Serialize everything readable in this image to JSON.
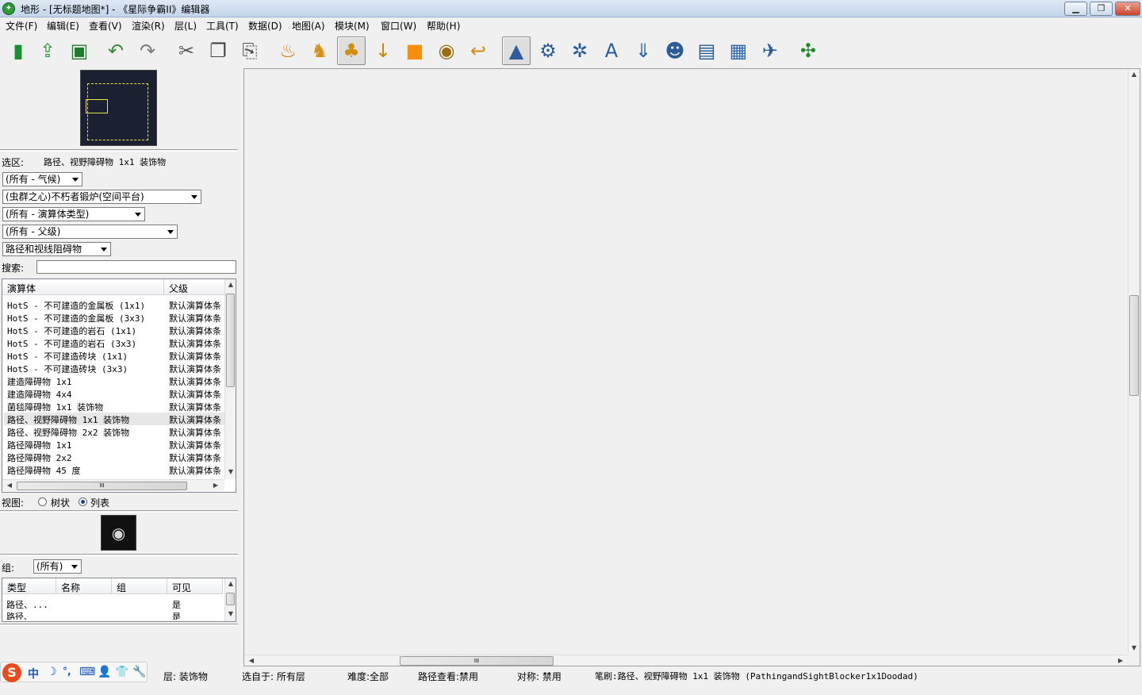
{
  "window": {
    "title": "地形 - [无标题地图*] - 《星际争霸II》编辑器",
    "minimize": "▁",
    "maximize": "❐",
    "close": "✕"
  },
  "menu": [
    "文件(F)",
    "编辑(E)",
    "查看(V)",
    "渲染(R)",
    "层(L)",
    "工具(T)",
    "数据(D)",
    "地图(A)",
    "模块(M)",
    "窗口(W)",
    "帮助(H)"
  ],
  "toolbar": {
    "buttons": [
      {
        "name": "new-map",
        "glyph": "▮",
        "color": "#1d8f2e"
      },
      {
        "name": "open-map",
        "glyph": "⇪",
        "color": "#2f8f3a"
      },
      {
        "name": "save-map",
        "glyph": "▣",
        "color": "#1e7d2c"
      },
      {
        "name": "undo",
        "glyph": "↶",
        "color": "#3f8a3a"
      },
      {
        "name": "redo",
        "glyph": "↷",
        "color": "#7a7a7a"
      },
      {
        "name": "cut",
        "glyph": "✂",
        "color": "#555"
      },
      {
        "name": "copy",
        "glyph": "❐",
        "color": "#444"
      },
      {
        "name": "paste",
        "glyph": "⎘",
        "color": "#555"
      },
      {
        "name": "terrain",
        "glyph": "♨",
        "color": "#d07b12"
      },
      {
        "name": "units",
        "glyph": "♞",
        "color": "#d49018"
      },
      {
        "name": "doodads",
        "glyph": "♣",
        "color": "#d38d13",
        "active": true
      },
      {
        "name": "points",
        "glyph": "↓",
        "color": "#c8860c"
      },
      {
        "name": "regions",
        "glyph": "■",
        "color": "#f5900e"
      },
      {
        "name": "cameras",
        "glyph": "◉",
        "color": "#9a6d12"
      },
      {
        "name": "paths",
        "glyph": "↩",
        "color": "#cf8b15"
      },
      {
        "name": "terrain-module",
        "glyph": "▲",
        "color": "#2f5b9a",
        "active": true
      },
      {
        "name": "data-module",
        "glyph": "⚙",
        "color": "#2c5c96"
      },
      {
        "name": "triggers-module",
        "glyph": "✲",
        "color": "#2d5a94"
      },
      {
        "name": "text-module",
        "glyph": "A",
        "color": "#2d5d99"
      },
      {
        "name": "import-module",
        "glyph": "⇓",
        "color": "#2d63a4"
      },
      {
        "name": "ai-module",
        "glyph": "☻",
        "color": "#2c5c96"
      },
      {
        "name": "cutscene-module",
        "glyph": "▤",
        "color": "#24578f"
      },
      {
        "name": "previewer-module",
        "glyph": "▦",
        "color": "#2d66a8"
      },
      {
        "name": "ui-module",
        "glyph": "✈",
        "color": "#2b5a96"
      },
      {
        "name": "test-map",
        "glyph": "✣",
        "color": "#1e8a2a"
      }
    ]
  },
  "palette": {
    "selection_label": "选区:",
    "selection_value": "路径、视野障碍物 1x1 装饰物",
    "filters": [
      "(所有 - 气候)",
      "(虫群之心)不朽者锻炉(空间平台)",
      "(所有 - 演算体类型)",
      "(所有 - 父级)",
      "路径和视线阻碍物"
    ],
    "search_label": "搜索:",
    "search_value": "",
    "columns": [
      "演算体",
      "父级"
    ],
    "rows": [
      {
        "name": "HotS - 不可建造的金属板 (1x1)",
        "parent": "默认演算体条"
      },
      {
        "name": "HotS - 不可建造的金属板 (3x3)",
        "parent": "默认演算体条"
      },
      {
        "name": "HotS - 不可建造的岩石 (1x1)",
        "parent": "默认演算体条"
      },
      {
        "name": "HotS - 不可建造的岩石 (3x3)",
        "parent": "默认演算体条"
      },
      {
        "name": "HotS - 不可建造砖块 (1x1)",
        "parent": "默认演算体条"
      },
      {
        "name": "HotS - 不可建造砖块 (3x3)",
        "parent": "默认演算体条"
      },
      {
        "name": "建造障碍物 1x1",
        "parent": "默认演算体条"
      },
      {
        "name": "建造障碍物 4x4",
        "parent": "默认演算体条"
      },
      {
        "name": "菌毯障碍物 1x1 装饰物",
        "parent": "默认演算体条"
      },
      {
        "name": "路径、视野障碍物 1x1 装饰物",
        "parent": "默认演算体条",
        "selected": true
      },
      {
        "name": "路径、视野障碍物 2x2 装饰物",
        "parent": "默认演算体条"
      },
      {
        "name": "路径障碍物 1x1",
        "parent": "默认演算体条"
      },
      {
        "name": "路径障碍物 2x2",
        "parent": "默认演算体条"
      },
      {
        "name": "路径障碍物 45 度",
        "parent": "默认演算体条"
      }
    ],
    "hscroll_grip": "III",
    "view_label": "视图:",
    "view_tree": "树状",
    "view_list": "列表",
    "view_selected": "列表"
  },
  "layers": {
    "group_label": "组:",
    "group_value": "(所有)",
    "columns": [
      "类型",
      "名称",
      "组",
      "可见"
    ],
    "rows": [
      {
        "type": "路径、...",
        "name": "",
        "group": "",
        "visible": "是"
      },
      {
        "type": "路径、",
        "name": "",
        "group": "",
        "visible": "是"
      }
    ]
  },
  "viewport": {
    "hscroll_grip": "III"
  },
  "ime": {
    "logo": "S",
    "items": [
      "中",
      "☽",
      "°,",
      "⌨",
      "👤",
      "👕",
      "🔧"
    ]
  },
  "status": [
    "层: 装饰物",
    "选自于: 所有层",
    "难度:全部",
    "路径查看:禁用",
    "对称: 禁用",
    "笔刷:路径、视野障碍物 1x1 装饰物 (PathingandSightBlocker1x1Doodad)"
  ]
}
